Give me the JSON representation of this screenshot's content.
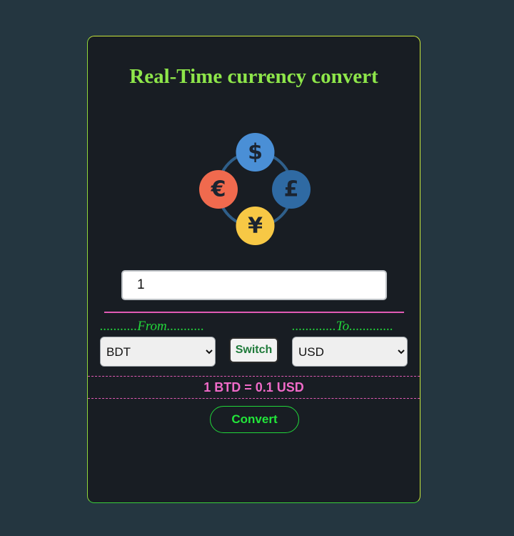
{
  "page": {
    "title": "Real-Time currency convert"
  },
  "logo": {
    "icon": "currency-exchange-icon",
    "symbols": {
      "top": "$",
      "right": "£",
      "bottom": "¥",
      "left": "€"
    },
    "colors": {
      "ring": "#2f5f8a",
      "dollar": "#4a8fd6",
      "pound": "#2f6aa3",
      "yen": "#f7c845",
      "euro": "#f06a4e",
      "symbol": "#1b2430"
    }
  },
  "amount": {
    "value": "1"
  },
  "from": {
    "label": "...........From...........",
    "selected": "BDT"
  },
  "to": {
    "label": ".............To.............",
    "selected": "USD"
  },
  "switch_label": "Switch",
  "result": "1 BTD = 0.1 USD",
  "convert_label": "Convert",
  "colors": {
    "background": "#243640",
    "card": "#181d23",
    "title": "#8ee64a",
    "accent_green": "#22d63a",
    "accent_pink": "#f06ac8"
  }
}
